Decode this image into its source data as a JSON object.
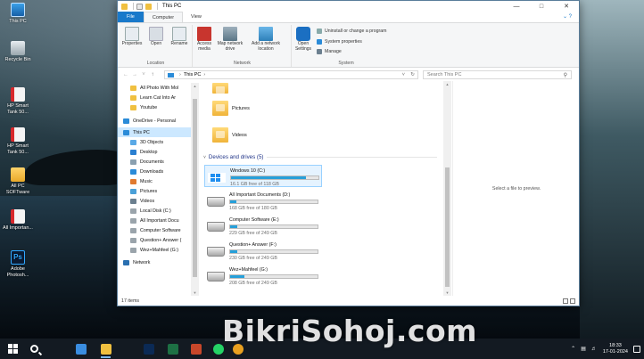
{
  "desktop": {
    "icons": [
      {
        "label": "This PC",
        "icon": "computer-icon"
      },
      {
        "label": "Recycle Bin",
        "icon": "recycle-bin-icon"
      },
      {
        "label": "HP Smart Tank 50...",
        "icon": "pdf-icon"
      },
      {
        "label": "HP Smart Tank 50...",
        "icon": "pdf-icon"
      },
      {
        "label": "All PC SOFTware",
        "icon": "folder-icon"
      },
      {
        "label": "All Importan...",
        "icon": "pdf-icon"
      },
      {
        "label": "Adobe Photosh...",
        "icon": "photoshop-icon"
      }
    ]
  },
  "window": {
    "title": "This PC",
    "tabs": {
      "file": "File",
      "computer": "Computer",
      "view": "View"
    },
    "ribbon": {
      "location": {
        "label": "Location",
        "buttons": [
          "Properties",
          "Open",
          "Rename"
        ]
      },
      "network": {
        "label": "Network",
        "buttons": [
          "Access media",
          "Map network drive",
          "Add a network location"
        ]
      },
      "system": {
        "label": "System",
        "open_settings": "Open Settings",
        "items": [
          "Uninstall or change a program",
          "System properties",
          "Manage"
        ]
      }
    },
    "address": {
      "path": "This PC",
      "search_placeholder": "Search This PC"
    },
    "nav": [
      {
        "label": "All Photo With Mol",
        "icon": "folder-icon",
        "selected": false
      },
      {
        "label": "Learn Cat Into Ar",
        "icon": "folder-icon",
        "selected": false
      },
      {
        "label": "Youtube",
        "icon": "folder-icon",
        "selected": false
      },
      {
        "label": "OneDrive - Personal",
        "icon": "onedrive-icon",
        "selected": false
      },
      {
        "label": "This PC",
        "icon": "computer-icon",
        "selected": true
      },
      {
        "label": "3D Objects",
        "icon": "cube-icon",
        "selected": false
      },
      {
        "label": "Desktop",
        "icon": "desktop-icon",
        "selected": false
      },
      {
        "label": "Documents",
        "icon": "documents-icon",
        "selected": false
      },
      {
        "label": "Downloads",
        "icon": "download-icon",
        "selected": false
      },
      {
        "label": "Music",
        "icon": "music-icon",
        "selected": false
      },
      {
        "label": "Pictures",
        "icon": "pictures-icon",
        "selected": false
      },
      {
        "label": "Videos",
        "icon": "videos-icon",
        "selected": false
      },
      {
        "label": "Local Disk (C:)",
        "icon": "drive-icon",
        "selected": false
      },
      {
        "label": "All Important Docu",
        "icon": "drive-icon",
        "selected": false
      },
      {
        "label": "Computer Software",
        "icon": "drive-icon",
        "selected": false
      },
      {
        "label": "Question+ Answer (",
        "icon": "drive-icon",
        "selected": false
      },
      {
        "label": "Wez+Mahfeel (G:)",
        "icon": "drive-icon",
        "selected": false
      },
      {
        "label": "Network",
        "icon": "network-icon",
        "selected": false
      }
    ],
    "folders": [
      {
        "label": "",
        "icon": "folder-icon"
      },
      {
        "label": "Pictures",
        "icon": "pictures-folder-icon"
      },
      {
        "label": "Videos",
        "icon": "videos-folder-icon"
      }
    ],
    "devices_heading": "Devices and drives (5)",
    "drives": [
      {
        "name": "Windows 10 (C:)",
        "free": "16.1 GB free of 118 GB",
        "used_fraction": 0.86,
        "icon": "windows-drive-icon",
        "selected": true
      },
      {
        "name": "All Important Documents (D:)",
        "free": "168 GB free of 180 GB",
        "used_fraction": 0.07,
        "icon": "hard-drive-icon",
        "selected": false
      },
      {
        "name": "Computer Software (E:)",
        "free": "229 GB free of 249 GB",
        "used_fraction": 0.08,
        "icon": "hard-drive-icon",
        "selected": false
      },
      {
        "name": "Question+ Answer (F:)",
        "free": "230 GB free of 249 GB",
        "used_fraction": 0.08,
        "icon": "hard-drive-icon",
        "selected": false
      },
      {
        "name": "Wez+Mahfeel (G:)",
        "free": "208 GB free of 249 GB",
        "used_fraction": 0.16,
        "icon": "hard-drive-icon",
        "selected": false
      }
    ],
    "preview_message": "Select a file to preview.",
    "status": "17 items"
  },
  "taskbar": {
    "time": "18:33",
    "date": "17-01-2024",
    "apps": [
      "task-view-icon",
      "file-explorer-icon",
      "photoshop-icon",
      "excel-icon",
      "powerpoint-icon",
      "whatsapp-icon",
      "chrome-icon",
      "chrome-icon"
    ]
  },
  "watermark": "BikriSohoj.com",
  "colors": {
    "accent": "#1979ca",
    "selection": "#cce8ff",
    "drive_bar": "#26a0da",
    "heading": "#1e3287"
  }
}
